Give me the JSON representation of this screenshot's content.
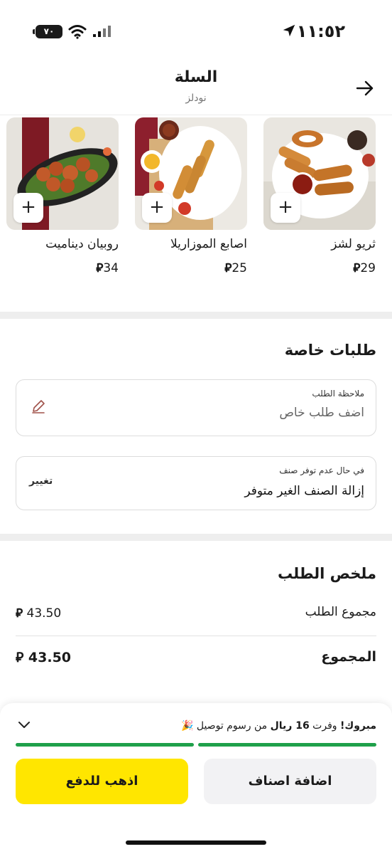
{
  "status_bar": {
    "time": "١١:٥٢",
    "battery": "٧٠"
  },
  "header": {
    "title": "السلة",
    "subtitle": "نودلز"
  },
  "products": [
    {
      "name": "ثريو لشز",
      "price": "29",
      "currency": "⃁",
      "image": "chicken-tenders-onion-rings"
    },
    {
      "name": "اصابع الموزاريلا",
      "price": "25",
      "currency": "⃁",
      "image": "mozzarella-sticks"
    },
    {
      "name": "روبيان ديناميت",
      "price": "34",
      "currency": "⃁",
      "image": "dynamite-shrimp"
    }
  ],
  "add_label": "+",
  "special_requests": {
    "title": "طلبات خاصة",
    "note_label": "ملاحظة الطلب",
    "note_placeholder": "اضف طلب خاص",
    "unavailable_label": "في حال عدم توفر صنف",
    "unavailable_value": "إزالة الصنف الغير متوفر",
    "change_label": "تغيير"
  },
  "summary": {
    "title": "ملخص الطلب",
    "subtotal_label": "مجموع الطلب",
    "subtotal_value": "43.50",
    "total_label": "المجموع",
    "total_value": "43.50",
    "currency": "⃁"
  },
  "promo": {
    "bold": "مبروك!",
    "text1": " وفرت ",
    "amount": "16 ريال",
    "text2": " من رسوم توصيل ",
    "emoji": "🎉"
  },
  "buttons": {
    "checkout": "اذهب للدفع",
    "add_items": "اضافة اصناف"
  },
  "colors": {
    "accent": "#ffe600",
    "progress": "#1fa04a"
  }
}
